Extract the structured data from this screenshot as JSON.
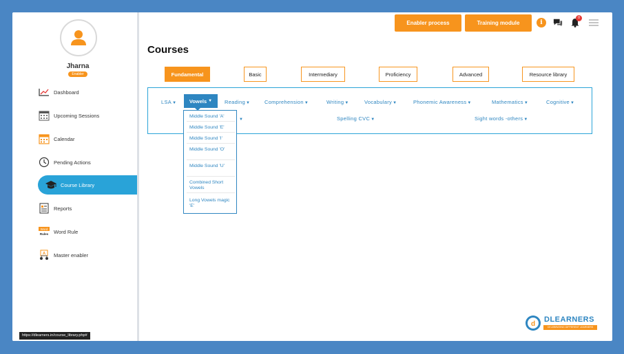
{
  "user": {
    "name": "Jharna",
    "role": "Enabler"
  },
  "sidebar": {
    "items": [
      {
        "label": "Dashboard",
        "icon": "chart-icon"
      },
      {
        "label": "Upcoming Sessions",
        "icon": "calendar-grid-icon"
      },
      {
        "label": "Calendar",
        "icon": "calendar-icon"
      },
      {
        "label": "Pending Actions",
        "icon": "clock-icon"
      },
      {
        "label": "Course Library",
        "icon": "graduation-cap-icon"
      },
      {
        "label": "Reports",
        "icon": "report-icon"
      },
      {
        "label": "Word Rule",
        "icon": "word-rules-icon"
      },
      {
        "label": "Master enabler",
        "icon": "master-enabler-icon"
      }
    ],
    "active": "Course Library"
  },
  "topbar": {
    "enabler_process": "Enabler process",
    "training_module": "Training module",
    "notification_count": "0"
  },
  "page": {
    "title": "Courses"
  },
  "levels": [
    "Fundamental",
    "Basic",
    "Intermediary",
    "Proficiency",
    "Advanced",
    "Resource library"
  ],
  "categories_row1": [
    "LSA",
    "Vowels",
    "Reading",
    "Comprehension",
    "Writing",
    "Vocabulary",
    "Phonemic Awareness",
    "Mathematics",
    "Cognitive"
  ],
  "categories_row2": [
    "Spelling CVC",
    "Sight words -others"
  ],
  "dropdown": [
    "Middle Sound 'A'",
    "Middle Sound 'E'",
    "Middle Sound 'I'",
    "Middle Sound 'O'",
    "Middle Sound 'U'",
    "Combined Short Vowels",
    "Long Vowels magic 'E'"
  ],
  "status_url": "https://dlearners.in/course_library.php#",
  "logo": {
    "name": "DLEARNERS",
    "tagline": "CELEBRATING DIFFERENT LEARNERS"
  },
  "colors": {
    "accent_orange": "#f7941d",
    "accent_blue": "#2e86c1",
    "frame_blue": "#4a86c4"
  }
}
